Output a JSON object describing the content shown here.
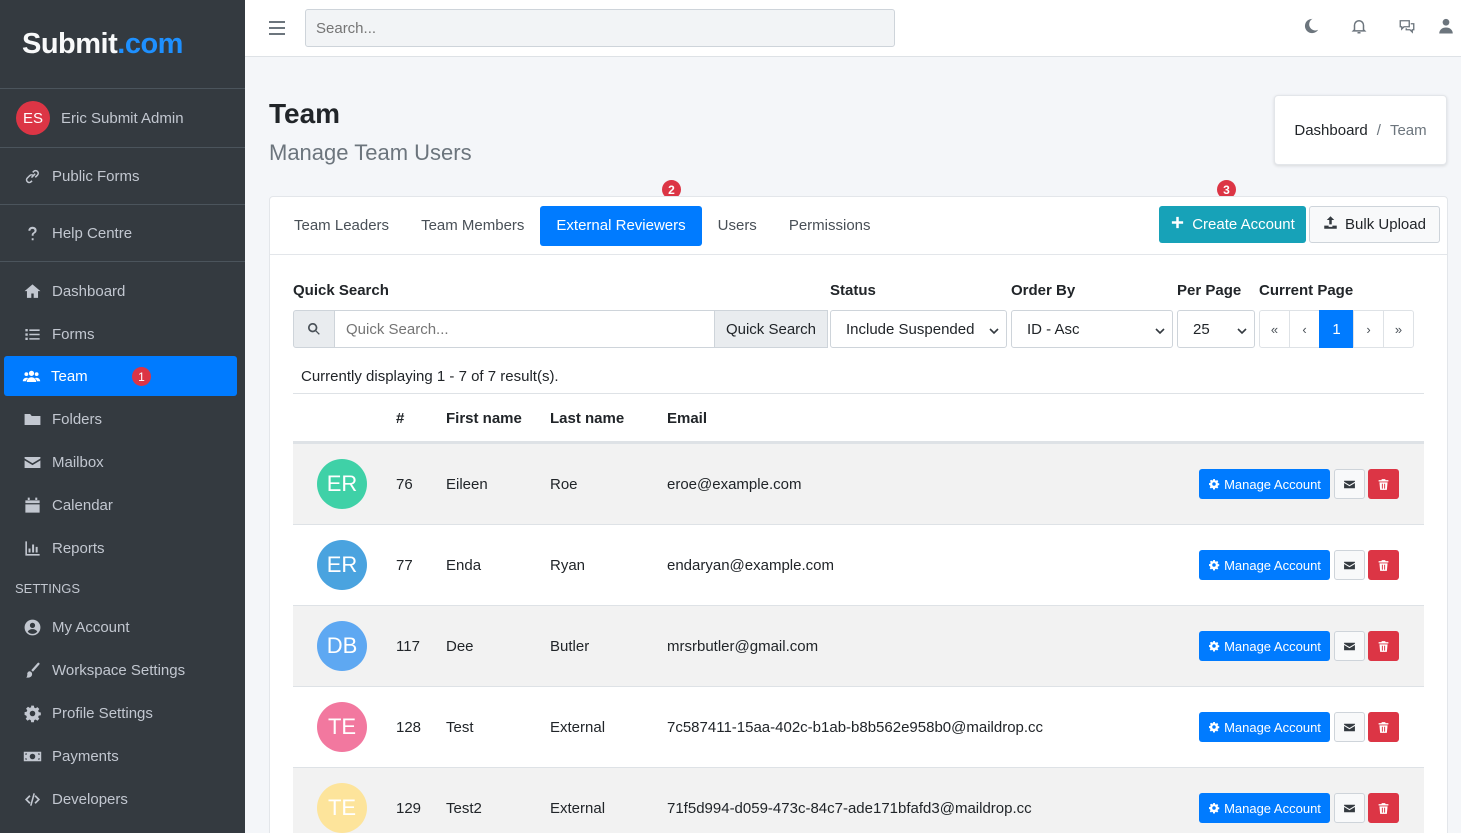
{
  "brand": {
    "name": "Submit",
    "suffix": ".com"
  },
  "user": {
    "initials": "ES",
    "name": "Eric Submit Admin"
  },
  "sidebar": {
    "top_items": [
      {
        "label": "Public Forms",
        "icon": "link-icon"
      },
      {
        "label": "Help Centre",
        "icon": "question-icon"
      }
    ],
    "items": [
      {
        "label": "Dashboard",
        "icon": "home-icon"
      },
      {
        "label": "Forms",
        "icon": "list-icon"
      },
      {
        "label": "Team",
        "icon": "users-icon",
        "active": true,
        "badge": "1"
      },
      {
        "label": "Folders",
        "icon": "folder-icon"
      },
      {
        "label": "Mailbox",
        "icon": "envelope-icon"
      },
      {
        "label": "Calendar",
        "icon": "calendar-icon"
      },
      {
        "label": "Reports",
        "icon": "chart-icon"
      }
    ],
    "settings_header": "SETTINGS",
    "settings_items": [
      {
        "label": "My Account",
        "icon": "user-circle-icon"
      },
      {
        "label": "Workspace Settings",
        "icon": "brush-icon"
      },
      {
        "label": "Profile Settings",
        "icon": "gear-icon"
      },
      {
        "label": "Payments",
        "icon": "money-icon"
      },
      {
        "label": "Developers",
        "icon": "code-icon"
      }
    ]
  },
  "topbar": {
    "search_placeholder": "Search..."
  },
  "page": {
    "title": "Team",
    "subtitle": "Manage Team Users"
  },
  "breadcrumb": {
    "home": "Dashboard",
    "sep": "/",
    "current": "Team"
  },
  "tabs": [
    "Team Leaders",
    "Team Members",
    "External Reviewers",
    "Users",
    "Permissions"
  ],
  "active_tab": "External Reviewers",
  "annotations": {
    "tab": "2",
    "create": "3"
  },
  "buttons": {
    "create": "Create Account",
    "bulk": "Bulk Upload"
  },
  "filters": {
    "quick_search_label": "Quick Search",
    "quick_search_placeholder": "Quick Search...",
    "quick_search_button": "Quick Search",
    "status_label": "Status",
    "status_value": "Include Suspended",
    "order_label": "Order By",
    "order_value": "ID - Asc",
    "per_page_label": "Per Page",
    "per_page_value": "25",
    "current_page_label": "Current Page",
    "pager": [
      "«",
      "‹",
      "1",
      "›",
      "»"
    ]
  },
  "result_text": "Currently displaying 1 - 7 of 7 result(s).",
  "table": {
    "headers": [
      "#",
      "First name",
      "Last name",
      "Email"
    ],
    "manage_label": "Manage Account",
    "rows": [
      {
        "initials": "ER",
        "color": "#3fd1a7",
        "id": "76",
        "first": "Eileen",
        "last": "Roe",
        "email": "eroe@example.com"
      },
      {
        "initials": "ER",
        "color": "#4aa3df",
        "id": "77",
        "first": "Enda",
        "last": "Ryan",
        "email": "endaryan@example.com"
      },
      {
        "initials": "DB",
        "color": "#5ea8f2",
        "id": "117",
        "first": "Dee",
        "last": "Butler",
        "email": "mrsrbutler@gmail.com"
      },
      {
        "initials": "TE",
        "color": "#f2789f",
        "id": "128",
        "first": "Test",
        "last": "External",
        "email": "7c587411-15aa-402c-b1ab-b8b562e958b0@maildrop.cc"
      },
      {
        "initials": "TE",
        "color": "#fde49b",
        "id": "129",
        "first": "Test2",
        "last": "External",
        "email": "71f5d994-d059-473c-84c7-ade171bfafd3@maildrop.cc"
      }
    ]
  }
}
